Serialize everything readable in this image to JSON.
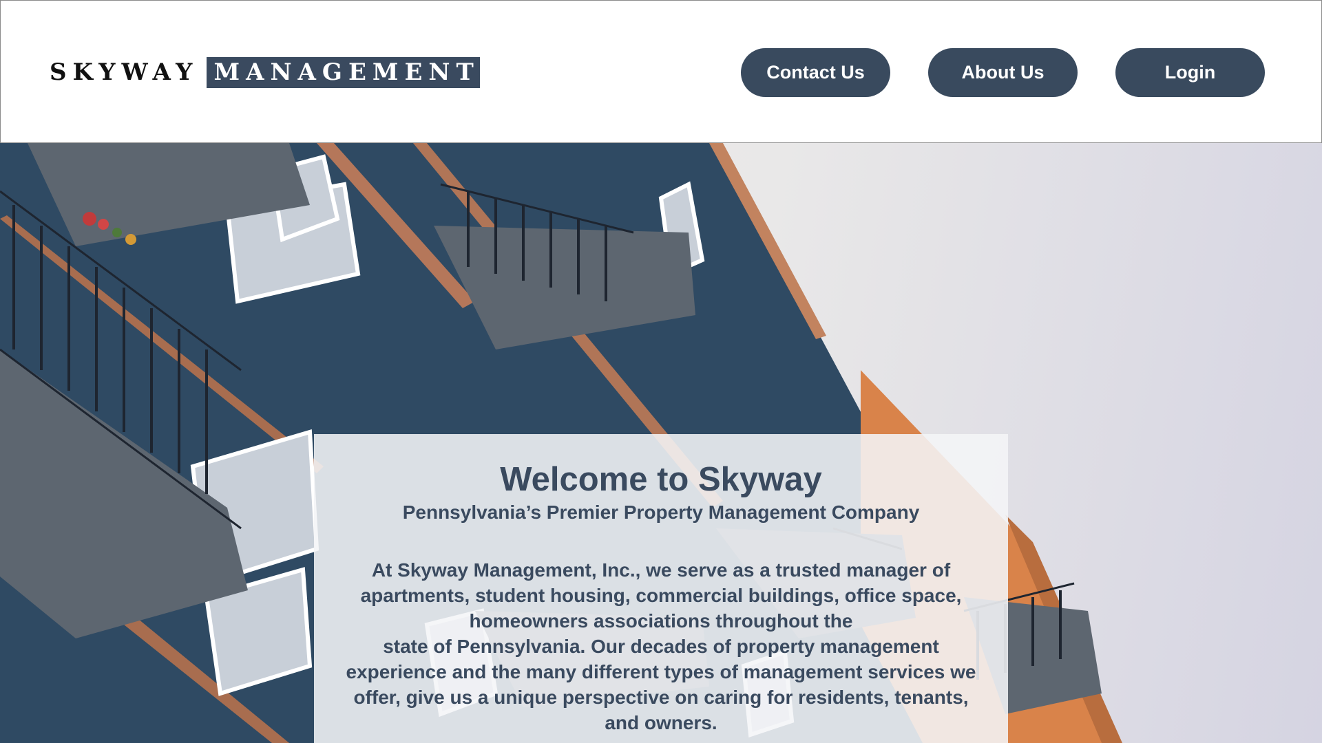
{
  "header": {
    "logo": {
      "word1": "SKYWAY",
      "word2": "MANAGEMENT"
    },
    "nav": [
      {
        "label": "Contact Us"
      },
      {
        "label": "About Us"
      },
      {
        "label": "Login"
      }
    ]
  },
  "hero": {
    "background_image": "apartment-building-photo",
    "card": {
      "title": "Welcome to Skyway",
      "subtitle": "Pennsylvania’s Premier Property Management Company",
      "body_lines": [
        "At Skyway Management, Inc., we serve as a trusted manager of",
        "apartments, student housing, commercial buildings, office space,",
        "homeowners associations throughout the",
        "state of Pennsylvania. Our decades of property management",
        "experience and the many different types of management services we",
        "offer, give us a unique perspective on caring for residents, tenants,",
        "and owners."
      ]
    }
  },
  "colors": {
    "brand_navy": "#394a5e",
    "card_text": "#3a4a5f",
    "building_blue": "#2e4a63",
    "accent_orange": "#e08a4a"
  }
}
